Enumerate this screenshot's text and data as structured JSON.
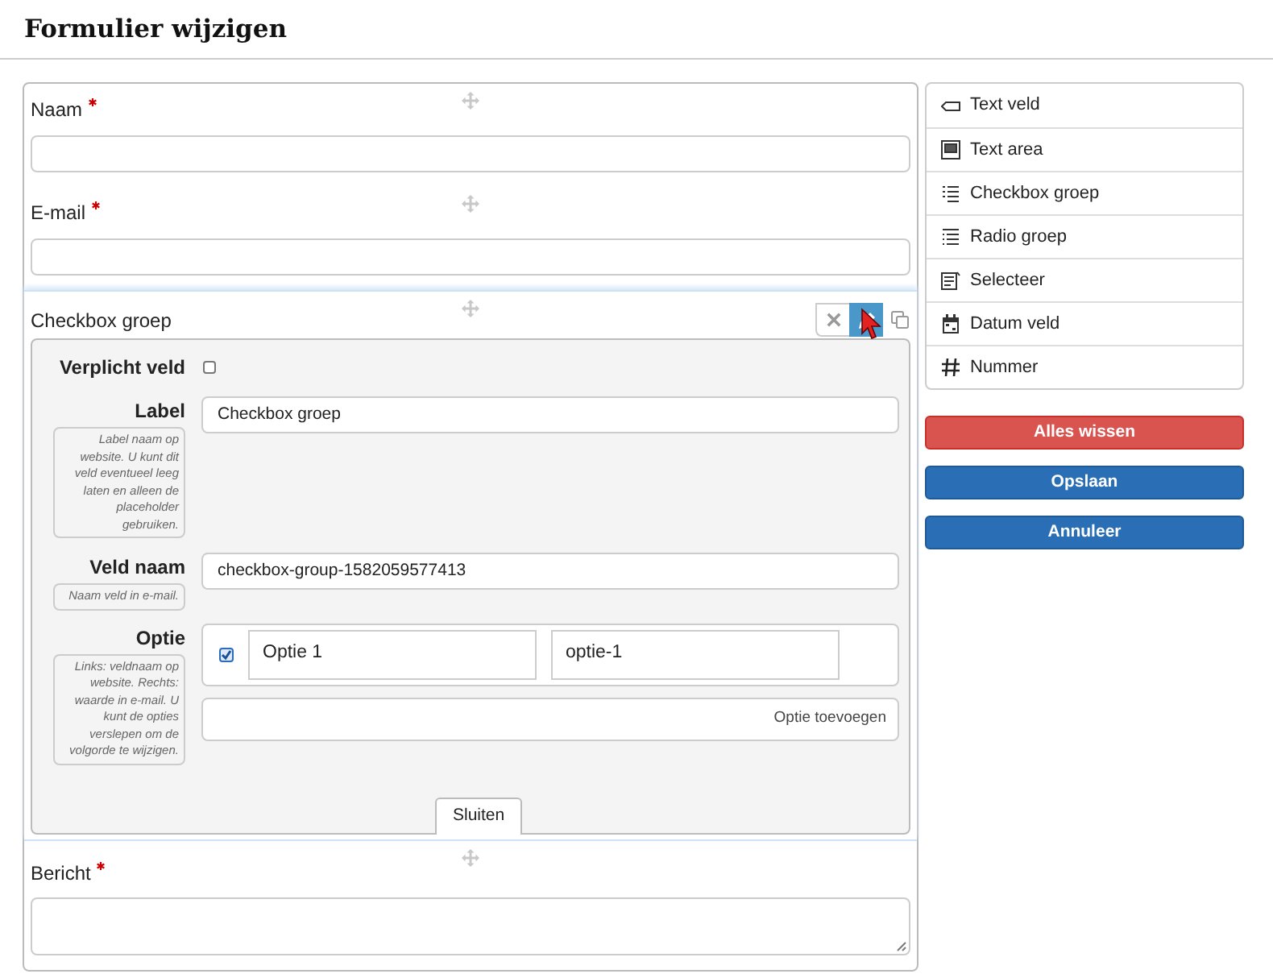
{
  "title": "Formulier wijzigen",
  "fields": [
    {
      "kind": "input",
      "label": "Naam",
      "required": true
    },
    {
      "kind": "input",
      "label": "E-mail",
      "required": true
    },
    {
      "kind": "checkbox_group",
      "label": "Checkbox groep",
      "required": false,
      "toolbar": [
        {
          "kind": "remove",
          "selected": false
        },
        {
          "kind": "edit",
          "selected": true
        },
        {
          "kind": "copy",
          "selected": false
        }
      ],
      "editor": {
        "required_field": {
          "label": "Verplicht veld",
          "checked": false
        },
        "rows": [
          {
            "label": "Label",
            "help": "Label naam op website. U kunt dit veld eventueel leeg laten en alleen de placeholder gebruiken.",
            "value": "Checkbox groep"
          },
          {
            "label": "Veld naam",
            "help": "Naam veld in e-mail.",
            "value": "checkbox-group-1582059577413"
          }
        ],
        "options": {
          "label": "Optie",
          "help": "Links: veldnaam op website. Rechts: waarde in e-mail. U kunt de opties verslepen om de volgorde te wijzigen.",
          "items": [
            {
              "checked": true,
              "label": "Optie 1",
              "value": "optie-1"
            }
          ],
          "add_button": "Optie toevoegen"
        },
        "close_button": "Sluiten"
      }
    },
    {
      "kind": "textarea",
      "label": "Bericht",
      "required": true
    }
  ],
  "palette": [
    {
      "kind": "text-field",
      "label": "Text veld"
    },
    {
      "kind": "text-area",
      "label": "Text area"
    },
    {
      "kind": "checklist",
      "label": "Checkbox groep"
    },
    {
      "kind": "list",
      "label": "Radio groep"
    },
    {
      "kind": "select",
      "label": "Selecteer"
    },
    {
      "kind": "calendar",
      "label": "Datum veld"
    },
    {
      "kind": "hash",
      "label": "Nummer"
    }
  ],
  "actions": [
    {
      "kind": "danger",
      "label": "Alles wissen"
    },
    {
      "kind": "primary",
      "label": "Opslaan"
    },
    {
      "kind": "primary",
      "label": "Annuleer"
    }
  ]
}
